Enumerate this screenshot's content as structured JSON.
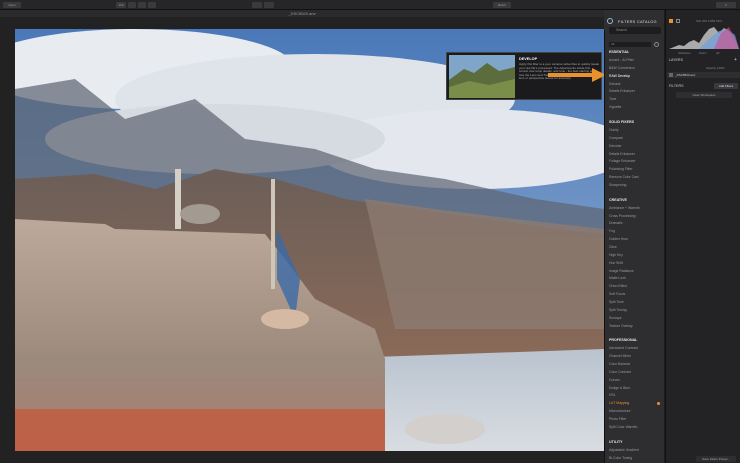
{
  "toolbar": {
    "open_label": "Open",
    "zoom_label": "100",
    "batch_label": "Batch",
    "right_label": "≡"
  },
  "document": {
    "filename": "_DSC8520.arw"
  },
  "catalog": {
    "title": "FILTERS CATALOG",
    "search_placeholder": "Search",
    "filter_value": "All",
    "sections": [
      {
        "name": "ESSENTIAL",
        "items": [
          "Accent - AI Filter",
          "B&W Conversion",
          "RAW Develop",
          "Dehaze",
          "Details Enhancer",
          "Tone",
          "Vignette"
        ]
      },
      {
        "name": "SOLID FIXERS",
        "items": [
          "Clarity",
          "Compare",
          "Denoise",
          "Details Enhancer",
          "Foliage Enhancer",
          "Polarizing Filter",
          "Remove Color Cast",
          "Sharpening"
        ]
      },
      {
        "name": "CREATIVE",
        "items": [
          "Ambiance + Warmth",
          "Cross Processing",
          "Dramatic",
          "Fog",
          "Golden Hour",
          "Glow",
          "High Key",
          "Hue Shift",
          "Image Radiance",
          "Matte Look",
          "Orton Effect",
          "Soft Focus",
          "Split Tone",
          "Split Toning",
          "Sunrays",
          "Texture Overlay"
        ]
      },
      {
        "name": "PROFESSIONAL",
        "items": [
          "Advanced Contrast",
          "Channel Mixer",
          "Color Balance",
          "Color Contrast",
          "Curves",
          "Dodge & Burn",
          "HSL",
          "LUT Mapping",
          "Microstructure",
          "Photo Filter",
          "Split Color Warmth"
        ]
      },
      {
        "name": "UTILITY",
        "items": [
          "Adjustable Gradient",
          "Bi-Color Toning"
        ]
      }
    ],
    "selected_item": "RAW Develop",
    "highlighted_item": "LUT Mapping"
  },
  "tooltip": {
    "title": "DEVELOP",
    "body": "Apply this filter to a your camera native files to quickly tweak your raw file's processed. The Adjustments inside this control over temp details, and tone - the best starting point. Use the Lens and Transform tabs to compensate for any lens or perspective issues for accuracy."
  },
  "right_panel": {
    "info": "ISO 200  1/250  f/8.0",
    "histogram_labels": [
      "Shadows",
      "Zoom",
      "All"
    ],
    "layers_label": "LAYERS",
    "layer_opacity": "Opacity 100%",
    "layer_name": "_DSC8520.arw",
    "filters_label": "FILTERS",
    "add_filters_label": "Add Filters",
    "workspace_label": "Clear Workspace",
    "save_preset_label": "Save Filters Preset..."
  },
  "colors": {
    "accent": "#e8922e",
    "panel_bg": "#2e2e31"
  }
}
